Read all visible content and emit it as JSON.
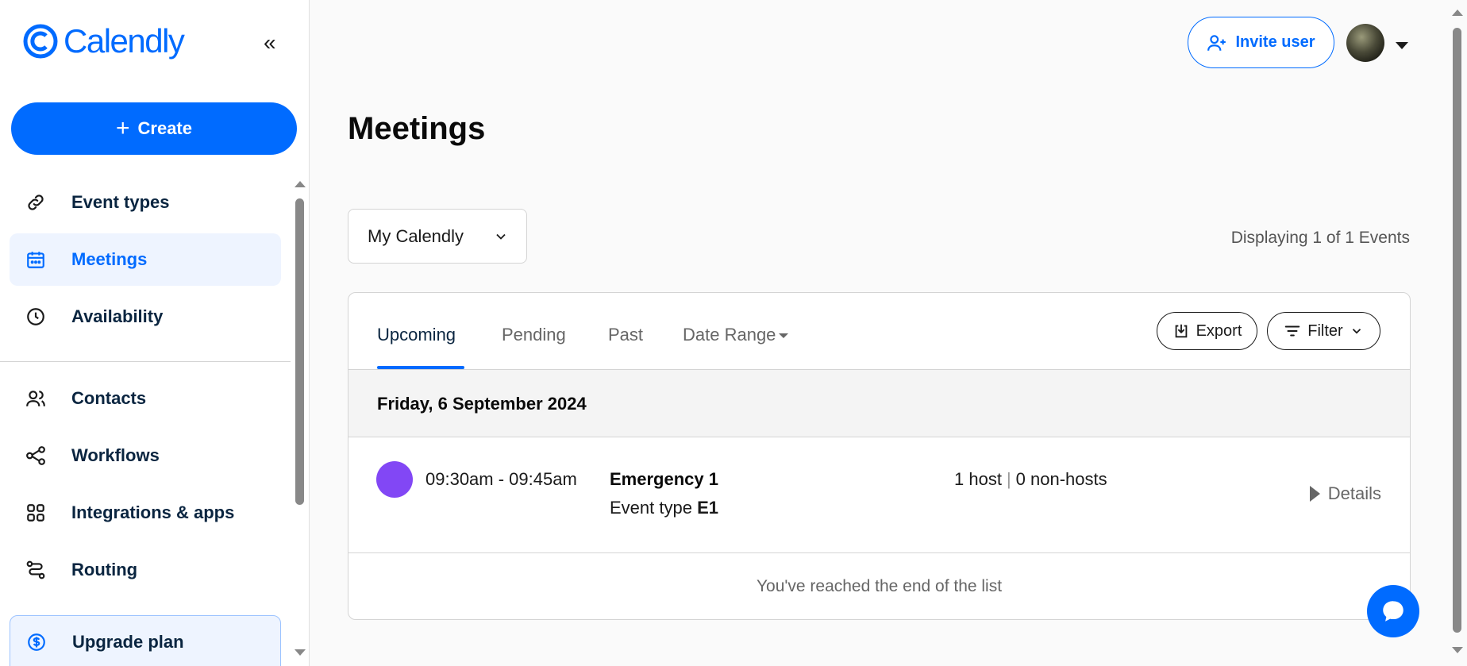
{
  "app": {
    "brand": "Calendly",
    "accent": "#006bff"
  },
  "sidebar": {
    "create_label": "Create",
    "items": [
      {
        "label": "Event types",
        "icon": "link-icon"
      },
      {
        "label": "Meetings",
        "icon": "calendar-icon",
        "active": true
      },
      {
        "label": "Availability",
        "icon": "clock-icon"
      },
      {
        "label": "Contacts",
        "icon": "contacts-icon"
      },
      {
        "label": "Workflows",
        "icon": "workflow-icon"
      },
      {
        "label": "Integrations & apps",
        "icon": "apps-grid-icon"
      },
      {
        "label": "Routing",
        "icon": "routing-icon"
      }
    ],
    "upgrade_label": "Upgrade plan"
  },
  "header": {
    "invite_label": "Invite user"
  },
  "main": {
    "title": "Meetings",
    "calendar_select": "My Calendly",
    "displaying": "Displaying 1 of 1 Events",
    "tabs": [
      "Upcoming",
      "Pending",
      "Past",
      "Date Range"
    ],
    "export_label": "Export",
    "filter_label": "Filter",
    "date_header": "Friday, 6 September 2024",
    "event": {
      "time": "09:30am - 09:45am",
      "name": "Emergency 1",
      "type_prefix": "Event type",
      "type_code": "E1",
      "hosts": "1 host",
      "non_hosts": "0 non-hosts",
      "details_label": "Details",
      "color": "#8247f5"
    },
    "end_of_list": "You've reached the end of the list"
  }
}
